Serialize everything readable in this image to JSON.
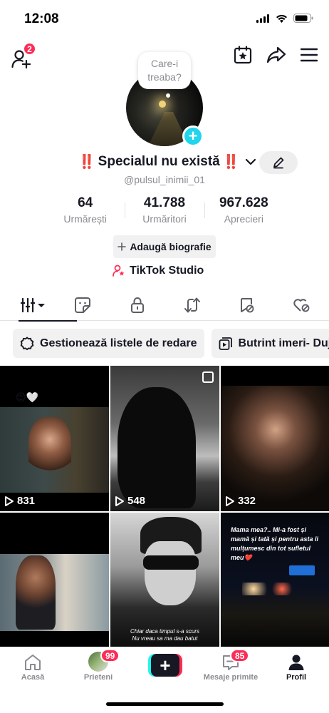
{
  "status_bar": {
    "time": "12:08"
  },
  "top_bar": {
    "friend_requests_badge": "2"
  },
  "avatar": {
    "note_text": "Care-i treaba?"
  },
  "profile": {
    "display_name_prefix": "‼️",
    "display_name": "Specialul nu există",
    "display_name_suffix": "‼️",
    "username": "@pulsul_inimii_01"
  },
  "stats": [
    {
      "value": "64",
      "label": "Urmărești"
    },
    {
      "value": "41.788",
      "label": "Urmăritori"
    },
    {
      "value": "967.628",
      "label": "Aprecieri"
    }
  ],
  "bio_button": {
    "label": "Adaugă biografie",
    "icon": "plus-icon"
  },
  "studio": {
    "label": "TikTok Studio",
    "icon": "person-star-icon"
  },
  "tabs": [
    {
      "name": "videos",
      "icon": "grid-bars-icon",
      "active": true
    },
    {
      "name": "stickers",
      "icon": "sticker-icon",
      "active": false
    },
    {
      "name": "private",
      "icon": "lock-icon",
      "active": false
    },
    {
      "name": "reposts",
      "icon": "repost-icon",
      "active": false
    },
    {
      "name": "favorites",
      "icon": "bookmark-icon",
      "active": false
    },
    {
      "name": "liked",
      "icon": "hidden-heart-icon",
      "active": false
    }
  ],
  "playlists": [
    {
      "label": "Gestionează listele de redare",
      "icon": "gear-icon"
    },
    {
      "label": "Butrint imeri- Duje",
      "icon": "playlist-icon"
    }
  ],
  "videos": [
    {
      "views": "831",
      "emoji": "😌🤍"
    },
    {
      "views": "548"
    },
    {
      "views": "332"
    },
    {
      "views": ""
    },
    {
      "views": "",
      "caption": "Chiar daca timpul s-a scurs\nNu vreau sa ma dau batut"
    },
    {
      "views": "",
      "overlay_text": "Mama mea?.. Mi-a fost și mamă și tată și pentru asta îi mulțumesc din tot sufletul meu❤️"
    }
  ],
  "bottom_nav": [
    {
      "label": "Acasă",
      "icon": "home-icon",
      "active": false
    },
    {
      "label": "Prieteni",
      "icon": "friends-avatar",
      "badge": "99",
      "active": false
    },
    {
      "label": "",
      "icon": "create-plus-icon",
      "active": false
    },
    {
      "label": "Mesaje primite",
      "icon": "inbox-icon",
      "badge": "85",
      "active": false
    },
    {
      "label": "Profil",
      "icon": "profile-icon",
      "active": true
    }
  ],
  "colors": {
    "accent_red": "#fe2c55",
    "accent_cyan": "#20d5ec",
    "text_primary": "#161823",
    "text_secondary": "#8a8b91"
  }
}
